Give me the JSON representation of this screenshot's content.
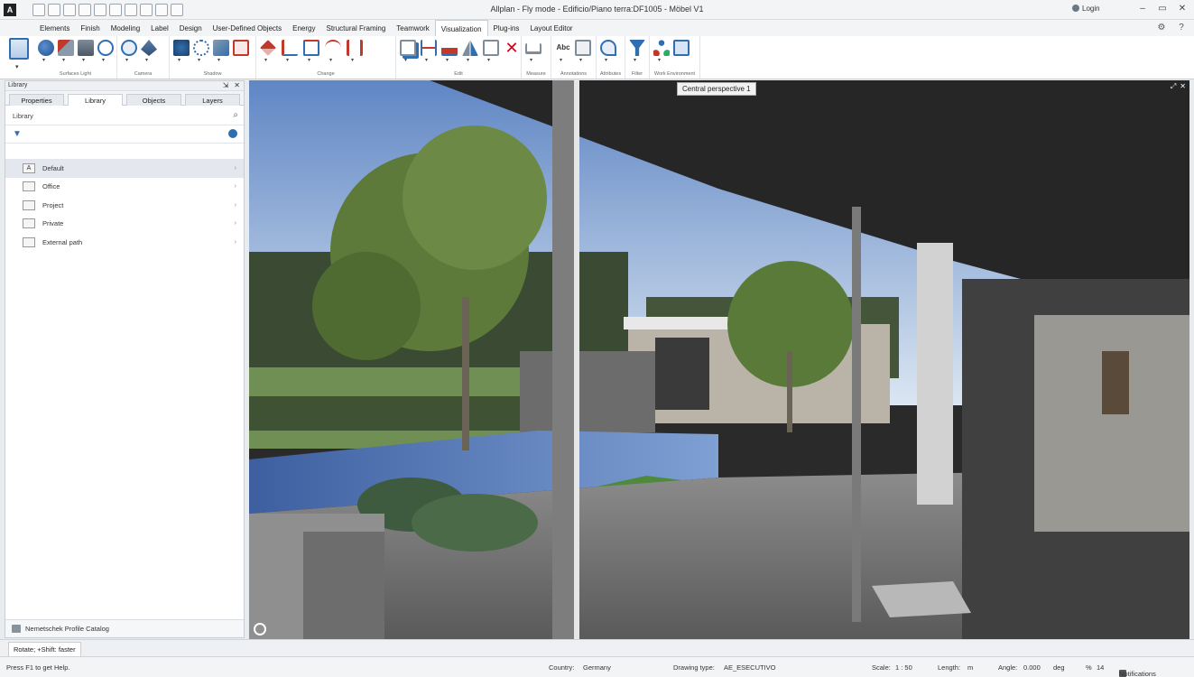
{
  "window": {
    "title": "Allplan - Fly mode - Edificio/Piano terra:DF1005 - Möbel V1",
    "login": "Login",
    "app_logo": "A"
  },
  "menu_tabs": [
    {
      "label": "Elements"
    },
    {
      "label": "Finish"
    },
    {
      "label": "Modeling"
    },
    {
      "label": "Label"
    },
    {
      "label": "Design"
    },
    {
      "label": "User-Defined Objects"
    },
    {
      "label": "Energy"
    },
    {
      "label": "Structural Framing"
    },
    {
      "label": "Teamwork"
    },
    {
      "label": "Visualization",
      "active": true
    },
    {
      "label": "Plug-ins"
    },
    {
      "label": "Layout Editor"
    }
  ],
  "ribbon_groups": [
    {
      "label": "Surfaces Light"
    },
    {
      "label": "Camera"
    },
    {
      "label": "Shadow"
    },
    {
      "label": "Change"
    },
    {
      "label": "Edit"
    },
    {
      "label": "Measure"
    },
    {
      "label": "Annotations"
    },
    {
      "label": "Attributes"
    },
    {
      "label": "Filter"
    },
    {
      "label": "Work Environment"
    }
  ],
  "panel": {
    "title": "Library",
    "tabs": [
      "Properties",
      "Library",
      "Objects",
      "Layers"
    ],
    "search_label": "Library",
    "items": [
      {
        "label": "Default",
        "icon": "A"
      },
      {
        "label": "Office",
        "icon": "folder"
      },
      {
        "label": "Project",
        "icon": "folder"
      },
      {
        "label": "Private",
        "icon": "folder"
      },
      {
        "label": "External path",
        "icon": "folder"
      }
    ],
    "footer": "Nemetschek Profile Catalog"
  },
  "viewport": {
    "label": "Central perspective 1"
  },
  "nav_hint": "Rotate; +Shift: faster",
  "status": {
    "help": "Press F1 to get Help.",
    "country_label": "Country:",
    "country": "Germany",
    "drawing_type_label": "Drawing type:",
    "drawing_type": "AE_ESECUTIVO",
    "scale_label": "Scale:",
    "scale": "1 : 50",
    "length_label": "Length:",
    "length": "m",
    "angle_label": "Angle:",
    "angle": "0.000",
    "angle_unit": "deg",
    "percent_label": "%",
    "percent": "14",
    "notifications": "Notifications"
  },
  "colors": {
    "accent": "#2f6fb1",
    "active_tab_border": "#c9ced4"
  }
}
